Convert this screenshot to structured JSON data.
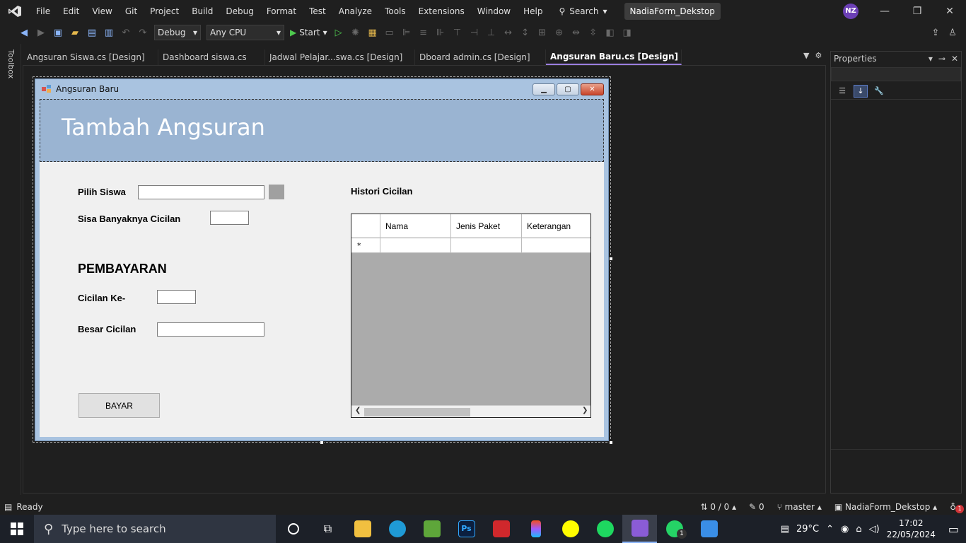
{
  "menu": {
    "items": [
      "File",
      "Edit",
      "View",
      "Git",
      "Project",
      "Build",
      "Debug",
      "Format",
      "Test",
      "Analyze",
      "Tools",
      "Extensions",
      "Window",
      "Help"
    ],
    "search_label": "Search",
    "solution_name": "NadiaForm_Dekstop",
    "avatar_initials": "NZ"
  },
  "toolbar": {
    "config": "Debug",
    "platform": "Any CPU",
    "start_label": "Start"
  },
  "toolbox": {
    "label": "Toolbox"
  },
  "tabs": [
    {
      "label": "Angsuran Siswa.cs [Design]"
    },
    {
      "label": "Dashboard siswa.cs"
    },
    {
      "label": "Jadwal Pelajar...swa.cs [Design]"
    },
    {
      "label": "Dboard admin.cs [Design]"
    },
    {
      "label": "Angsuran Baru.cs [Design]"
    }
  ],
  "form": {
    "title": "Angsuran Baru",
    "header": "Tambah Angsuran",
    "pilih_siswa": "Pilih Siswa",
    "sisa_cicilan": "Sisa Banyaknya Cicilan",
    "pembayaran": "PEMBAYARAN",
    "cicilan_ke": "Cicilan Ke-",
    "besar_cicilan": "Besar Cicilan",
    "bayar": "BAYAR",
    "histori": "Histori Cicilan",
    "grid": {
      "columns": [
        "Nama",
        "Jenis Paket",
        "Keterangan"
      ],
      "new_row_marker": "*"
    }
  },
  "properties": {
    "title": "Properties"
  },
  "status": {
    "ready": "Ready",
    "changes": "0 / 0",
    "edits": "0",
    "branch": "master",
    "repo": "NadiaForm_Dekstop",
    "notifications": "1"
  },
  "taskbar": {
    "search_placeholder": "Type here to search",
    "weather": "29°C",
    "time": "17:02",
    "date": "22/05/2024",
    "whatsapp_badge": "1"
  },
  "colors": {
    "accent": "#9b7fe0",
    "form_header": "#9ab4d2",
    "vs_bg": "#1f1f1f"
  }
}
